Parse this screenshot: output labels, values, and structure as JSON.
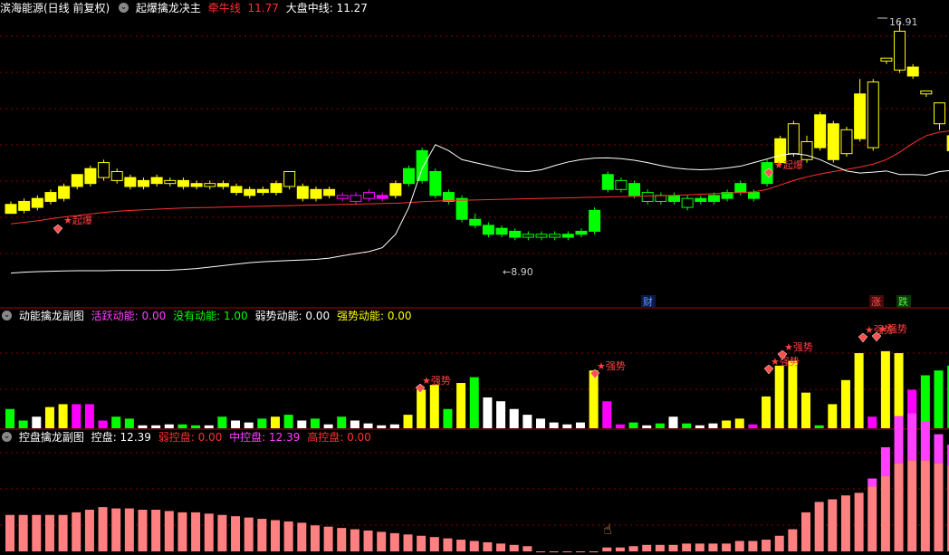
{
  "panels": {
    "main": {
      "stock": "滨海能源(日线 前复权)",
      "indicator": "起爆擒龙决主",
      "lines": [
        {
          "label": "牵牛线",
          "value": "11.77",
          "color": "#ff3030"
        },
        {
          "label": "大盘中线",
          "value": "11.27",
          "color": "#ffffff"
        }
      ],
      "annotations": {
        "high": "16.91",
        "low": "8.90",
        "tag1": "起爆",
        "tag2": "起爆",
        "cai": "财",
        "zhang": "涨",
        "die": "跌"
      }
    },
    "sub1": {
      "title": "动能擒龙副图",
      "fields": [
        {
          "label": "活跃动能",
          "value": "0.00",
          "color": "#ff40ff"
        },
        {
          "label": "没有动能",
          "value": "1.00",
          "color": "#00ff00"
        },
        {
          "label": "弱势动能",
          "value": "0.00",
          "color": "#ffffff"
        },
        {
          "label": "强势动能",
          "value": "0.00",
          "color": "#ffff00"
        }
      ],
      "tag": "强势"
    },
    "sub2": {
      "title": "控盘擒龙副图",
      "fields": [
        {
          "label": "控盘",
          "value": "12.39",
          "color": "#ffffff"
        },
        {
          "label": "弱控盘",
          "value": "0.00",
          "color": "#ff3030"
        },
        {
          "label": "中控盘",
          "value": "12.39",
          "color": "#ff40ff"
        },
        {
          "label": "高控盘",
          "value": "0.00",
          "color": "#ff3030"
        }
      ]
    }
  },
  "colors": {
    "yellow": "#ffff00",
    "green": "#00ff00",
    "magenta": "#ff00ff",
    "white": "#ffffff",
    "red": "#ff2020",
    "salmon": "#ff8080",
    "border": "#b00000"
  },
  "chart_data": [
    {
      "type": "candlestick",
      "ylim": [
        8.2,
        17.6
      ],
      "candles": [
        [
          "Y",
          11.0,
          11.3,
          11.1,
          11.4
        ],
        [
          "Y",
          11.1,
          11.4,
          11.0,
          11.5
        ],
        [
          "Y",
          11.2,
          11.5,
          11.1,
          11.6
        ],
        [
          "Y",
          11.4,
          11.7,
          11.3,
          11.8
        ],
        [
          "Y",
          11.5,
          11.9,
          11.4,
          12.0
        ],
        [
          "Y",
          11.9,
          12.3,
          11.8,
          12.3
        ],
        [
          "Y",
          12.0,
          12.5,
          11.9,
          12.6
        ],
        [
          "Yh",
          12.7,
          12.2,
          12.1,
          12.8
        ],
        [
          "Yh",
          12.4,
          12.1,
          12.0,
          12.5
        ],
        [
          "Y",
          11.9,
          12.2,
          11.8,
          12.3
        ],
        [
          "Y",
          11.9,
          12.1,
          11.8,
          12.2
        ],
        [
          "Y",
          12.0,
          12.2,
          11.9,
          12.3
        ],
        [
          "Yh",
          12.1,
          12.0,
          11.9,
          12.2
        ],
        [
          "Y",
          11.9,
          12.1,
          11.8,
          12.2
        ],
        [
          "Y",
          11.9,
          12.0,
          11.8,
          12.1
        ],
        [
          "Yh",
          12.0,
          11.9,
          11.8,
          12.1
        ],
        [
          "Y",
          11.9,
          12.0,
          11.8,
          12.1
        ],
        [
          "Y",
          11.7,
          11.9,
          11.6,
          12.0
        ],
        [
          "Y",
          11.6,
          11.8,
          11.5,
          11.9
        ],
        [
          "Y",
          11.7,
          11.8,
          11.6,
          11.9
        ],
        [
          "Y",
          11.7,
          12.0,
          11.6,
          12.1
        ],
        [
          "Yh",
          12.4,
          11.9,
          11.8,
          12.4
        ],
        [
          "Y",
          11.5,
          11.9,
          11.4,
          12.0
        ],
        [
          "Y",
          11.5,
          11.8,
          11.4,
          11.9
        ],
        [
          "Y",
          11.6,
          11.8,
          11.5,
          11.9
        ],
        [
          "Mh",
          11.6,
          11.5,
          11.4,
          11.7
        ],
        [
          "Mh",
          11.6,
          11.4,
          11.3,
          11.7
        ],
        [
          "Mh",
          11.7,
          11.5,
          11.4,
          11.8
        ],
        [
          "M",
          11.5,
          11.6,
          11.4,
          11.7
        ],
        [
          "Y",
          11.6,
          12.0,
          11.5,
          12.1
        ],
        [
          "G",
          12.0,
          12.5,
          11.9,
          12.6
        ],
        [
          "G",
          12.1,
          13.1,
          12.0,
          13.2
        ],
        [
          "G",
          12.4,
          11.6,
          11.5,
          12.5
        ],
        [
          "G",
          11.7,
          11.4,
          11.3,
          11.8
        ],
        [
          "G",
          11.5,
          10.8,
          10.7,
          11.6
        ],
        [
          "G",
          10.8,
          10.6,
          10.5,
          11.0
        ],
        [
          "G",
          10.6,
          10.3,
          10.2,
          10.7
        ],
        [
          "G",
          10.5,
          10.3,
          10.2,
          10.6
        ],
        [
          "G",
          10.4,
          10.2,
          10.1,
          10.5
        ],
        [
          "Gh",
          10.3,
          10.2,
          10.1,
          10.4
        ],
        [
          "Gh",
          10.3,
          10.2,
          10.1,
          10.4
        ],
        [
          "Gh",
          10.3,
          10.2,
          10.1,
          10.4
        ],
        [
          "G",
          10.2,
          10.3,
          10.1,
          10.4
        ],
        [
          "G",
          10.3,
          10.4,
          10.2,
          10.5
        ],
        [
          "G",
          10.4,
          11.1,
          10.3,
          11.2
        ],
        [
          "G",
          11.8,
          12.3,
          11.7,
          12.4
        ],
        [
          "Gh",
          12.1,
          11.8,
          11.7,
          12.2
        ],
        [
          "G",
          12.0,
          11.6,
          11.5,
          12.1
        ],
        [
          "Gh",
          11.7,
          11.4,
          11.3,
          11.8
        ],
        [
          "Gh",
          11.6,
          11.4,
          11.3,
          11.7
        ],
        [
          "G",
          11.6,
          11.4,
          11.3,
          11.7
        ],
        [
          "Gh",
          11.5,
          11.2,
          11.1,
          11.6
        ],
        [
          "G",
          11.4,
          11.5,
          11.3,
          11.6
        ],
        [
          "G",
          11.4,
          11.6,
          11.3,
          11.7
        ],
        [
          "G",
          11.5,
          11.7,
          11.4,
          11.8
        ],
        [
          "G",
          11.7,
          12.0,
          11.6,
          12.1
        ],
        [
          "G",
          11.7,
          11.5,
          11.4,
          11.8
        ],
        [
          "G",
          12.0,
          12.7,
          11.9,
          12.8
        ],
        [
          "Y",
          12.7,
          13.5,
          12.6,
          13.6
        ],
        [
          "Yh",
          14.0,
          13.0,
          12.9,
          14.1
        ],
        [
          "Yh",
          13.4,
          12.8,
          12.7,
          13.6
        ],
        [
          "Y",
          13.2,
          14.3,
          13.1,
          14.4
        ],
        [
          "Y",
          12.8,
          14.0,
          12.7,
          14.1
        ],
        [
          "Yh",
          13.8,
          13.0,
          12.9,
          13.9
        ],
        [
          "Y",
          13.5,
          15.0,
          13.4,
          15.5
        ],
        [
          "Yh",
          15.4,
          13.2,
          13.1,
          15.5
        ],
        [
          "Yh",
          16.2,
          16.1,
          16.0,
          16.2
        ],
        [
          "Yh",
          17.1,
          15.8,
          15.7,
          17.4
        ],
        [
          "Y",
          15.6,
          15.9,
          15.5,
          16.0
        ],
        [
          "Yh",
          15.1,
          15.0,
          14.9,
          15.1
        ],
        [
          "Yh",
          14.7,
          14.0,
          13.8,
          14.7
        ],
        [
          "Y",
          13.1,
          13.6,
          13.0,
          13.7
        ]
      ],
      "series": [
        {
          "name": "牵牛线",
          "color": "#ff3030",
          "values": [
            10.65,
            10.7,
            10.75,
            10.82,
            10.88,
            10.93,
            10.98,
            11.03,
            11.07,
            11.1,
            11.12,
            11.14,
            11.16,
            11.18,
            11.19,
            11.2,
            11.21,
            11.22,
            11.23,
            11.24,
            11.25,
            11.26,
            11.27,
            11.28,
            11.29,
            11.3,
            11.31,
            11.32,
            11.33,
            11.34,
            11.36,
            11.39,
            11.41,
            11.43,
            11.44,
            11.45,
            11.46,
            11.47,
            11.48,
            11.49,
            11.5,
            11.51,
            11.52,
            11.53,
            11.54,
            11.55,
            11.56,
            11.57,
            11.58,
            11.59,
            11.6,
            11.62,
            11.64,
            11.66,
            11.68,
            11.7,
            11.72,
            11.8,
            11.95,
            12.1,
            12.22,
            12.32,
            12.4,
            12.47,
            12.55,
            12.65,
            12.8,
            13.05,
            13.35,
            13.6,
            13.72,
            13.77
          ]
        },
        {
          "name": "大盘中线",
          "color": "#ffffff",
          "values": [
            9.0,
            9.03,
            9.05,
            9.06,
            9.07,
            9.08,
            9.08,
            9.08,
            9.09,
            9.09,
            9.09,
            9.09,
            9.1,
            9.12,
            9.15,
            9.2,
            9.25,
            9.3,
            9.35,
            9.38,
            9.4,
            9.42,
            9.44,
            9.46,
            9.5,
            9.58,
            9.65,
            9.72,
            9.85,
            10.3,
            11.2,
            12.5,
            13.3,
            13.1,
            12.8,
            12.7,
            12.6,
            12.5,
            12.42,
            12.4,
            12.46,
            12.6,
            12.72,
            12.8,
            12.85,
            12.86,
            12.83,
            12.78,
            12.7,
            12.6,
            12.52,
            12.48,
            12.46,
            12.48,
            12.52,
            12.58,
            12.7,
            12.82,
            12.95,
            13.0,
            12.95,
            12.8,
            12.6,
            12.42,
            12.35,
            12.38,
            12.42,
            12.3,
            12.3,
            12.28,
            12.4,
            12.44
          ]
        }
      ]
    },
    {
      "type": "bar",
      "ylim": [
        0,
        110
      ],
      "values": [
        20,
        8,
        12,
        22,
        25,
        25,
        25,
        8,
        12,
        10,
        3,
        3,
        4,
        4,
        3,
        3,
        12,
        8,
        6,
        10,
        12,
        14,
        8,
        10,
        4,
        12,
        8,
        5,
        3,
        4,
        14,
        40,
        45,
        20,
        47,
        53,
        32,
        28,
        20,
        14,
        10,
        6,
        4,
        6,
        60,
        28,
        4,
        6,
        3,
        5,
        12,
        5,
        3,
        5,
        8,
        10,
        4,
        33,
        65,
        70,
        37,
        3,
        25,
        50,
        78,
        12,
        80,
        78,
        40,
        55,
        60,
        65
      ],
      "colors": [
        "G",
        "G",
        "W",
        "Y",
        "Y",
        "M",
        "M",
        "M",
        "G",
        "G",
        "W",
        "W",
        "W",
        "G",
        "G",
        "W",
        "G",
        "W",
        "W",
        "G",
        "Y",
        "G",
        "W",
        "G",
        "W",
        "G",
        "W",
        "W",
        "W",
        "W",
        "Y",
        "Y",
        "Y",
        "G",
        "Y",
        "G",
        "W",
        "W",
        "W",
        "W",
        "W",
        "W",
        "W",
        "W",
        "Y",
        "M",
        "M",
        "G",
        "W",
        "G",
        "W",
        "G",
        "W",
        "W",
        "Y",
        "Y",
        "M",
        "Y",
        "Y",
        "Y",
        "Y",
        "G",
        "Y",
        "Y",
        "Y",
        "M",
        "Y",
        "Y",
        "M",
        "G",
        "G",
        "G"
      ]
    },
    {
      "type": "bar",
      "ylim": [
        0,
        80
      ],
      "values": [
        28,
        28,
        28,
        28,
        28,
        30,
        32,
        34,
        33,
        33,
        32,
        32,
        31,
        30,
        30,
        29,
        28,
        27,
        26,
        25,
        24,
        23,
        22,
        20,
        19,
        18,
        17,
        16,
        15,
        14,
        13,
        12,
        11,
        10,
        9,
        8,
        7,
        6,
        5,
        4,
        0,
        0,
        0,
        0,
        0,
        3,
        3,
        4,
        5,
        5,
        5,
        6,
        6,
        6,
        6,
        8,
        8,
        9,
        12,
        17,
        30,
        38,
        40,
        43,
        45,
        50,
        58,
        68,
        70,
        70,
        68,
        66
      ],
      "upper": [
        0,
        0,
        0,
        0,
        0,
        0,
        0,
        0,
        0,
        0,
        0,
        0,
        0,
        0,
        0,
        0,
        0,
        0,
        0,
        0,
        0,
        0,
        0,
        0,
        0,
        0,
        0,
        0,
        0,
        0,
        0,
        0,
        0,
        0,
        0,
        0,
        0,
        0,
        0,
        0,
        0,
        0,
        0,
        0,
        0,
        0,
        0,
        0,
        0,
        0,
        0,
        0,
        0,
        0,
        0,
        0,
        0,
        0,
        0,
        0,
        0,
        0,
        0,
        0,
        0,
        6,
        22,
        36,
        36,
        30,
        22,
        16
      ]
    }
  ]
}
